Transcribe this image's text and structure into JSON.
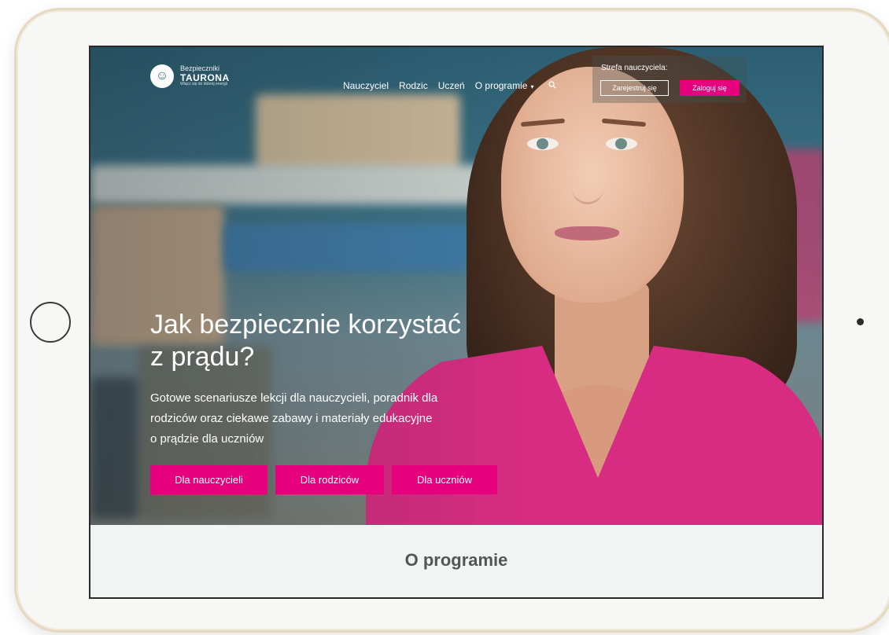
{
  "logo": {
    "line1": "Bezpieczniki",
    "line2": "TAURONA",
    "line3": "Włącz się do dobrej energii",
    "icon": "smiley-plug-icon"
  },
  "nav": {
    "items": [
      "Nauczyciel",
      "Rodzic",
      "Uczeń",
      "O programie"
    ],
    "dropdown_icon": "chevron-down-icon",
    "search_icon": "search-icon"
  },
  "teacher_zone": {
    "title": "Strefa nauczyciela:",
    "register": "Zarejestruj się",
    "login": "Zaloguj się"
  },
  "hero": {
    "title_line1": "Jak bezpiecznie korzystać",
    "title_line2": "z prądu?",
    "subtitle_line1": "Gotowe scenariusze lekcji dla nauczycieli, poradnik dla",
    "subtitle_line2": "rodziców oraz ciekawe zabawy i materiały edukacyjne",
    "subtitle_line3": "o prądzie dla uczniów",
    "buttons": [
      "Dla nauczycieli",
      "Dla rodziców",
      "Dla uczniów"
    ]
  },
  "section": {
    "title": "O programie"
  },
  "colors": {
    "accent": "#e6007e",
    "hero_blue": "#2c5f73"
  }
}
